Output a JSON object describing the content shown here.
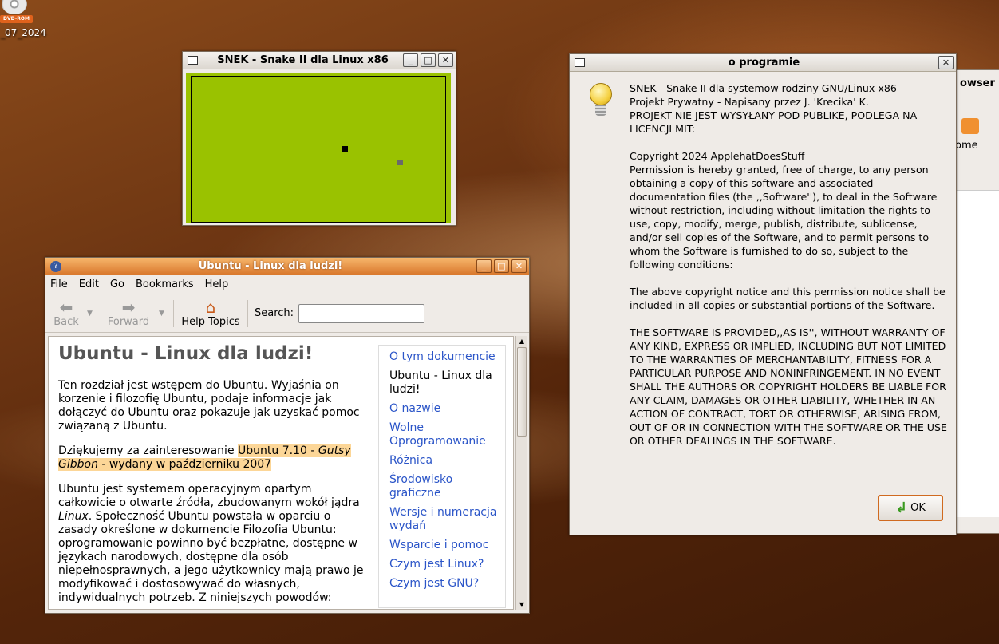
{
  "desktop": {
    "dvd_tag": "DVD-ROM",
    "dvd_label": "_07_2024"
  },
  "snek_window": {
    "title": "SNEK - Snake II dla Linux x86",
    "buttons": {
      "minimize": "_",
      "maximize": "□",
      "close": "✕"
    }
  },
  "help_window": {
    "title": "Ubuntu - Linux dla ludzi!",
    "menu": [
      "File",
      "Edit",
      "Go",
      "Bookmarks",
      "Help"
    ],
    "toolbar": {
      "back": "Back",
      "forward": "Forward",
      "help_topics": "Help Topics",
      "search_label": "Search:",
      "search_value": ""
    },
    "doc": {
      "heading": "Ubuntu - Linux dla ludzi!",
      "p1": "Ten rozdział jest wstępem do Ubuntu. Wyjaśnia on korzenie i filozofię Ubuntu, podaje informacje jak dołączyć do Ubuntu oraz pokazuje jak uzyskać pomoc związaną z Ubuntu.",
      "p2_a": "Dziękujemy za zainteresowanie ",
      "p2_hl1": "Ubuntu 7.10 - ",
      "p2_hl_em": "Gutsy Gibbon",
      "p2_hl2": " - wydany w październiku 2007",
      "p3_a": "Ubuntu jest systemem operacyjnym opartym całkowicie o otwarte źródła, zbudowanym wokół jądra ",
      "p3_em": "Linux",
      "p3_b": ". Społeczność Ubuntu powstała w oparciu o zasady określone w dokumencie Filozofia Ubuntu: oprogramowanie powinno być bezpłatne, dostępne w językach narodowych, dostępne dla osób niepełnosprawnych, a jego użytkownicy mają prawo je modyfikować i dostosowywać do własnych, indywidualnych potrzeb. Z niniejszych powodów:"
    },
    "toc": [
      "O tym dokumencie",
      "Ubuntu - Linux dla ludzi!",
      "O nazwie",
      "Wolne Oprogramowanie",
      "Różnica",
      "Środowisko graficzne",
      "Wersje i numeracja wydań",
      "Wsparcie i pomoc",
      "Czym jest Linux?",
      "Czym jest GNU?"
    ]
  },
  "about_dialog": {
    "title": "o programie",
    "text": "SNEK - Snake II dla systemow rodziny GNU/Linux x86\nProjekt Prywatny - Napisany przez J. 'Krecika' K.\nPROJEKT NIE JEST WYSYŁANY POD PUBLIKE, PODLEGA NA LICENCJI MIT:\n\nCopyright 2024 ApplehatDoesStuff\nPermission is hereby granted, free of charge, to any person obtaining a copy of this software and associated documentation files (the ,,Software''), to deal in the Software without restriction, including without limitation the rights to use, copy, modify, merge, publish, distribute, sublicense, and/or sell copies of the Software, and to permit persons to whom the Software is furnished to do so, subject to the following conditions:\n\nThe above copyright notice and this permission notice shall be included in all copies or substantial portions of the Software.\n\nTHE SOFTWARE IS PROVIDED,,AS IS'', WITHOUT WARRANTY OF ANY KIND, EXPRESS OR IMPLIED, INCLUDING BUT NOT LIMITED TO THE WARRANTIES OF MERCHANTABILITY, FITNESS FOR A PARTICULAR PURPOSE AND NONINFRINGEMENT. IN NO EVENT SHALL THE AUTHORS OR COPYRIGHT HOLDERS BE LIABLE FOR ANY CLAIM, DAMAGES OR OTHER LIABILITY, WHETHER IN AN ACTION OF CONTRACT, TORT OR OTHERWISE, ARISING FROM, OUT OF OR IN CONNECTION WITH THE SOFTWARE OR THE USE OR OTHER DEALINGS IN THE SOFTWARE.",
    "ok_label": "OK",
    "close": "✕"
  },
  "bg_browser": {
    "title_fragment": "owser",
    "home_fragment": "ome"
  }
}
